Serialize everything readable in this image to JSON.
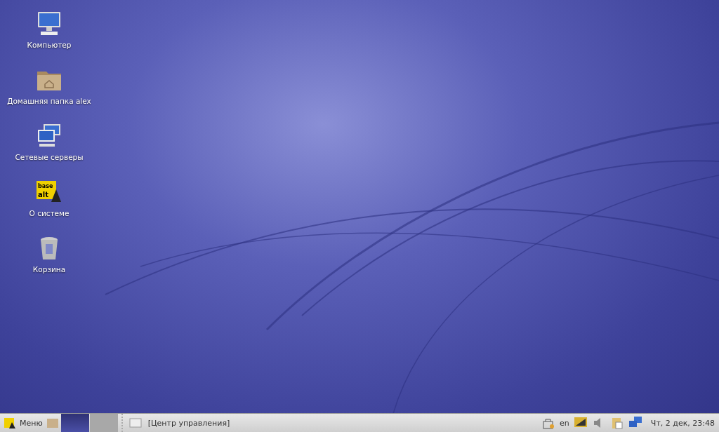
{
  "desktop_icons": [
    {
      "kind": "computer",
      "label": "Компьютер"
    },
    {
      "kind": "home",
      "label": "Домашняя папка alex"
    },
    {
      "kind": "network",
      "label": "Сетевые серверы"
    },
    {
      "kind": "about",
      "label": "О системе",
      "logo_top": "base",
      "logo_bottom": "alt"
    },
    {
      "kind": "trash",
      "label": "Корзина"
    }
  ],
  "taskbar": {
    "menu_label": "Меню",
    "workspaces": [
      {
        "selected": true
      },
      {
        "selected": false
      }
    ],
    "tasks": [
      {
        "label": "[Центр управления]"
      }
    ],
    "keyboard_layout": "en",
    "clock": "Чт,  2 дек, 23:48"
  }
}
